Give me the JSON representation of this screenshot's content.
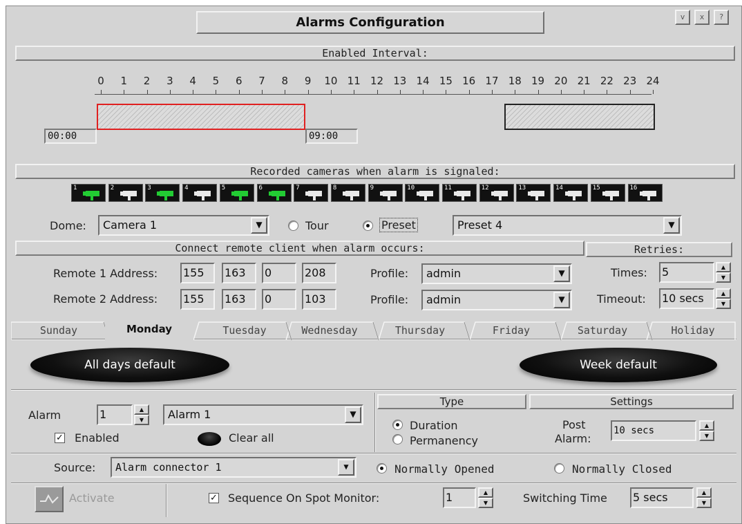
{
  "window": {
    "title": "Alarms Configuration",
    "buttons": [
      "v",
      "x",
      "?"
    ]
  },
  "interval": {
    "header": "Enabled Interval:",
    "hours": [
      "0",
      "1",
      "2",
      "3",
      "4",
      "5",
      "6",
      "7",
      "8",
      "9",
      "10",
      "11",
      "12",
      "13",
      "14",
      "15",
      "16",
      "17",
      "18",
      "19",
      "20",
      "21",
      "22",
      "23",
      "24"
    ],
    "start_time": "00:00",
    "end_time": "09:00"
  },
  "cameras": {
    "header": "Recorded cameras when alarm is signaled:",
    "items": [
      {
        "num": "1",
        "active": true
      },
      {
        "num": "2",
        "active": false
      },
      {
        "num": "3",
        "active": true
      },
      {
        "num": "4",
        "active": false
      },
      {
        "num": "5",
        "active": true
      },
      {
        "num": "6",
        "active": true
      },
      {
        "num": "7",
        "active": false
      },
      {
        "num": "8",
        "active": false
      },
      {
        "num": "9",
        "active": false
      },
      {
        "num": "10",
        "active": false
      },
      {
        "num": "11",
        "active": false
      },
      {
        "num": "12",
        "active": false
      },
      {
        "num": "13",
        "active": false
      },
      {
        "num": "14",
        "active": false
      },
      {
        "num": "15",
        "active": false
      },
      {
        "num": "16",
        "active": false
      }
    ],
    "active_color": "#22cc33",
    "inactive_color": "#e8e8e8"
  },
  "dome": {
    "label": "Dome:",
    "value": "Camera 1",
    "tour_label": "Tour",
    "preset_label": "Preset",
    "preset_selected": true,
    "preset_value": "Preset 4"
  },
  "remote": {
    "header": "Connect remote client when alarm occurs:",
    "rows": [
      {
        "label": "Remote 1 Address:",
        "ip": [
          "155",
          "163",
          "0",
          "208"
        ],
        "profile_label": "Profile:",
        "profile": "admin"
      },
      {
        "label": "Remote 2 Address:",
        "ip": [
          "155",
          "163",
          "0",
          "103"
        ],
        "profile_label": "Profile:",
        "profile": "admin"
      }
    ]
  },
  "retries": {
    "header": "Retries:",
    "times_label": "Times:",
    "times_value": "5",
    "timeout_label": "Timeout:",
    "timeout_value": "10 secs"
  },
  "tabs": [
    "Sunday",
    "Monday",
    "Tuesday",
    "Wednesday",
    "Thursday",
    "Friday",
    "Saturday",
    "Holiday"
  ],
  "active_tab": "Monday",
  "defaults": {
    "all_days": "All days default",
    "week": "Week default"
  },
  "alarm": {
    "label": "Alarm",
    "number": "1",
    "name": "Alarm 1",
    "enabled_label": "Enabled",
    "enabled": true,
    "clear_all": "Clear all"
  },
  "type": {
    "header": "Type",
    "duration": "Duration",
    "permanency": "Permanency",
    "selected": "Duration"
  },
  "settings": {
    "header": "Settings",
    "post_alarm_label_1": "Post",
    "post_alarm_label_2": "Alarm:",
    "post_alarm_value": "10 secs"
  },
  "source": {
    "label": "Source:",
    "value": "Alarm connector 1",
    "opened": "Normally Opened",
    "closed": "Normally Closed",
    "selected": "Normally Opened"
  },
  "footer": {
    "activate": "Activate",
    "sequence_label": "Sequence On Spot Monitor:",
    "sequence_checked": true,
    "sequence_value": "1",
    "switching_label": "Switching Time",
    "switching_value": "5 secs"
  }
}
